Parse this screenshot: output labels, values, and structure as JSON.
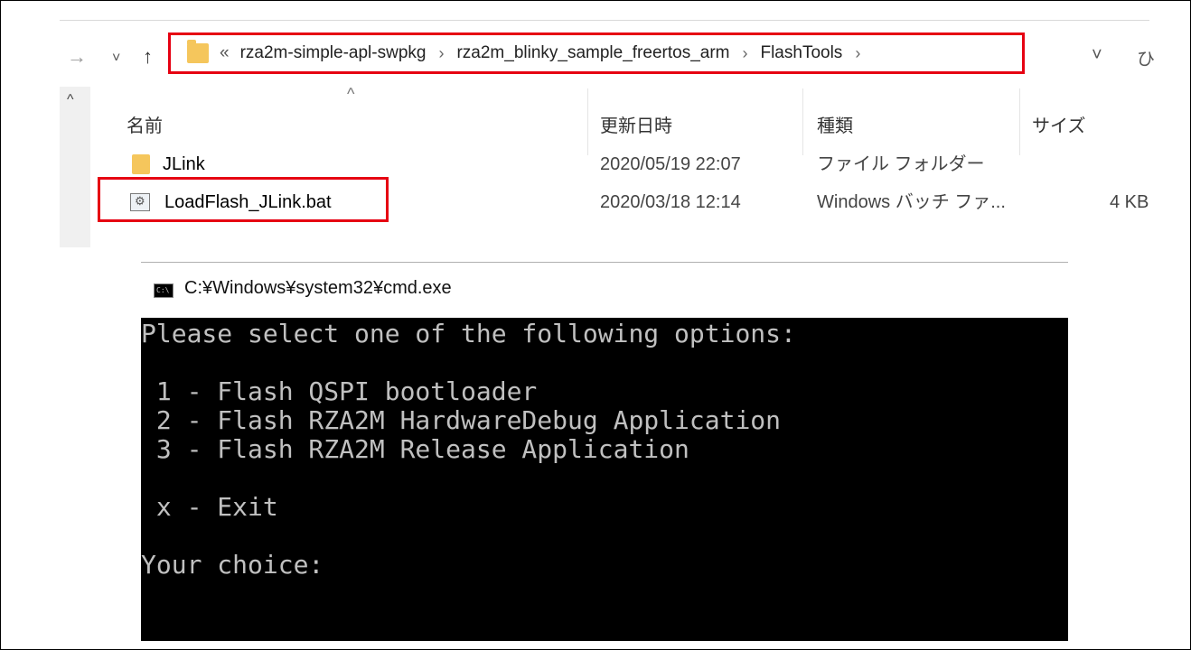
{
  "explorer": {
    "nav": {
      "back": "→",
      "down": "˅",
      "up": "↑"
    },
    "address": {
      "overflow": "«",
      "crumbs": [
        "rza2m-simple-apl-swpkg",
        "rza2m_blinky_sample_freertos_arm",
        "FlashTools"
      ],
      "separator": "›",
      "dropdown": "˅",
      "refresh": "ひ"
    },
    "sort_indicator": "^",
    "scroll_up": "^",
    "columns": {
      "name": "名前",
      "date": "更新日時",
      "type": "種類",
      "size": "サイズ"
    },
    "files": [
      {
        "name": "JLink",
        "date": "2020/05/19 22:07",
        "type": "ファイル フォルダー",
        "size": "",
        "icon": "folder-icon"
      },
      {
        "name": "LoadFlash_JLink.bat",
        "date": "2020/03/18 12:14",
        "type": "Windows バッチ ファ...",
        "size": "4 KB",
        "icon": "batch-file-icon"
      }
    ],
    "colors": {
      "highlight": "#e60012",
      "folder": "#f5c65c"
    }
  },
  "console": {
    "title": "C:¥Windows¥system32¥cmd.exe",
    "icon_text": "C:\\",
    "lines": [
      "Please select one of the following options:",
      " 1 - Flash QSPI bootloader",
      " 2 - Flash RZA2M HardwareDebug Application",
      " 3 - Flash RZA2M Release Application",
      " x - Exit",
      "Your choice:"
    ]
  }
}
